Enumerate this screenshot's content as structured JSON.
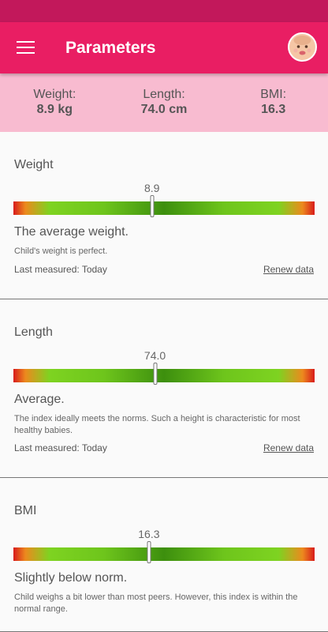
{
  "appbar": {
    "title": "Parameters",
    "avatar_icon": "baby-avatar-icon"
  },
  "summary": [
    {
      "label": "Weight:",
      "value": "8.9 kg"
    },
    {
      "label": "Length:",
      "value": "74.0 cm"
    },
    {
      "label": "BMI:",
      "value": "16.3"
    }
  ],
  "sections": [
    {
      "title": "Weight",
      "value": "8.9",
      "position_fraction": 0.46,
      "status": "The average weight.",
      "description": "Child's weight is perfect.",
      "last_measured": "Last measured: Today",
      "renew": "Renew data"
    },
    {
      "title": "Length",
      "value": "74.0",
      "position_fraction": 0.47,
      "status": "Average.",
      "description": "The index ideally meets the norms. Such a height is characteristic for most healthy babies.",
      "last_measured": "Last measured: Today",
      "renew": "Renew data"
    },
    {
      "title": "BMI",
      "value": "16.3",
      "position_fraction": 0.45,
      "status": "Slightly below norm.",
      "description": "Child weighs a bit lower than most peers. However, this index is within the normal range."
    }
  ],
  "colors": {
    "statusbar": "#c2185b",
    "appbar": "#e91e63",
    "summary_bg": "#f8bbd0"
  }
}
